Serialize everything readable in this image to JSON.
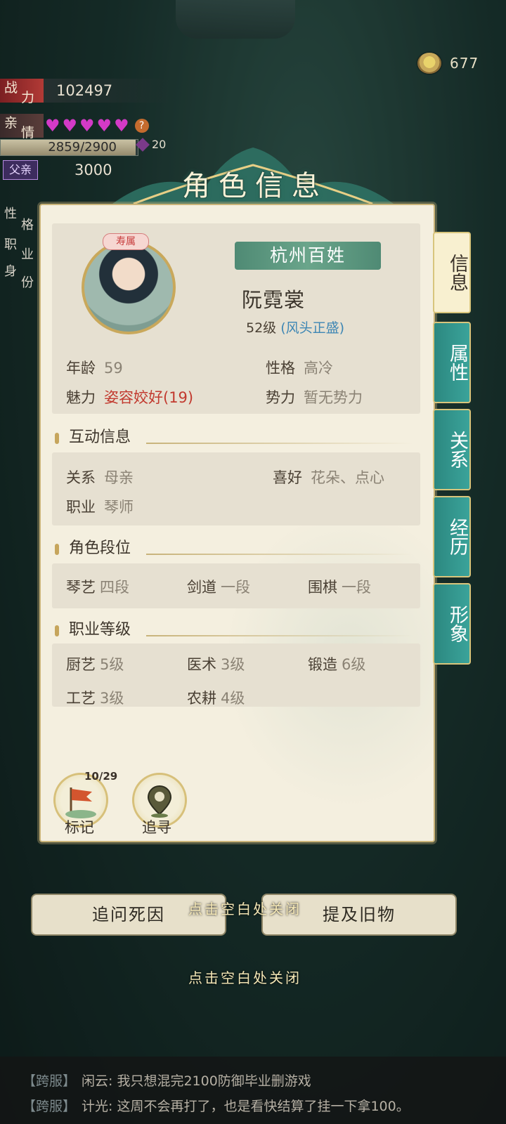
{
  "currency": {
    "value": "677",
    "icon": "tea-cup-icon"
  },
  "stats": {
    "power": {
      "label_1": "战",
      "label_2": "力",
      "value": "102497"
    },
    "kinship": {
      "label_1": "亲",
      "label_2": "情",
      "hearts": 5,
      "help": "?",
      "progress_text": "2859/2900",
      "progress": 0.9859,
      "extra": "20"
    },
    "father": {
      "button": "父亲",
      "value": "3000"
    },
    "side_labels": [
      {
        "a": "性",
        "b": "格"
      },
      {
        "a": "职",
        "b": "业"
      },
      {
        "a": "身",
        "b": "份"
      }
    ]
  },
  "modal": {
    "title": "角色信息",
    "portrait_badge": "寿属",
    "faction": "杭州百姓",
    "name": "阮霓裳",
    "level": "52级",
    "level_status": "(风头正盛)",
    "basic": {
      "age_label": "年龄",
      "age": "59",
      "temper_label": "性格",
      "temper": "高冷",
      "charm_label": "魅力",
      "charm": "姿容姣好(19)",
      "power_label": "势力",
      "power": "暂无势力"
    },
    "interaction": {
      "title": "互动信息",
      "relation_label": "关系",
      "relation": "母亲",
      "hobby_label": "喜好",
      "hobby": "花朵、点心",
      "job_label": "职业",
      "job": "琴师"
    },
    "ranks": {
      "title": "角色段位",
      "items": [
        {
          "label": "琴艺",
          "value": "四段"
        },
        {
          "label": "剑道",
          "value": "一段"
        },
        {
          "label": "围棋",
          "value": "一段"
        }
      ]
    },
    "career": {
      "title": "职业等级",
      "items": [
        {
          "label": "厨艺",
          "value": "5级"
        },
        {
          "label": "医术",
          "value": "3级"
        },
        {
          "label": "锻造",
          "value": "6级"
        },
        {
          "label": "工艺",
          "value": "3级"
        },
        {
          "label": "农耕",
          "value": "4级"
        }
      ]
    },
    "bottom": {
      "mark_label": "标记",
      "mark_count": "10/29",
      "track_label": "追寻"
    },
    "tabs": [
      "信息",
      "属性",
      "关系",
      "经历",
      "形象"
    ]
  },
  "actions": {
    "ask_death": "追问死因",
    "mention_item": "提及旧物",
    "close_hint_1": "点击空白处关闭",
    "close_hint_2": "点击空白处关闭"
  },
  "chat": [
    {
      "channel": "【跨服】",
      "text": "闲云: 我只想混完2100防御毕业删游戏"
    },
    {
      "channel": "【跨服】",
      "text": "计光: 这周不会再打了，也是看快结算了挂一下拿100。"
    }
  ],
  "colors": {
    "accent_teal": "#3aa39a",
    "gold": "#c9b378",
    "charm_red": "#c23a2f",
    "status_blue": "#3d86b4"
  }
}
